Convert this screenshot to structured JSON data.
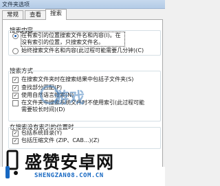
{
  "window": {
    "title": "文件夹选项"
  },
  "tabs": [
    {
      "label": "常规"
    },
    {
      "label": "查看"
    },
    {
      "label": "搜索"
    }
  ],
  "search_content": {
    "heading": "搜索内容",
    "options": [
      {
        "label": "在有索引的位置搜索文件名和内容(I)。在没有索引的位置，只搜索文件名。",
        "selected": true
      },
      {
        "label": "始终搜索文件名和内容(此过程可能需要几分钟)(C)",
        "selected": false
      }
    ]
  },
  "search_method": {
    "heading": "搜索方式",
    "options": [
      {
        "label": "在搜索文件夹时在搜索结果中包括子文件夹(S)",
        "checked": true
      },
      {
        "label": "查找部分匹配(P)",
        "checked": true
      },
      {
        "label": "使用自然语言搜索(N)",
        "checked": true
      },
      {
        "label": "在文件夹中搜索系统文件时不使用索引(此过程可能需要较长时间)(D)",
        "checked": false
      }
    ]
  },
  "non_indexed": {
    "heading": "在搜索没有索引的位置时",
    "options": [
      {
        "label": "包括系统目录(Y)",
        "checked": true
      },
      {
        "label": "包括压缩文件 (ZIP、CAB...)(Z)",
        "checked": true
      }
    ]
  },
  "watermark": {
    "text": "游戏"
  },
  "branding": {
    "name": "盛赞安卓网",
    "url": "SHENGZAN08.COM.CN"
  },
  "colors": {
    "accent": "#1a5fb4",
    "url_blue": "#1768c2"
  }
}
